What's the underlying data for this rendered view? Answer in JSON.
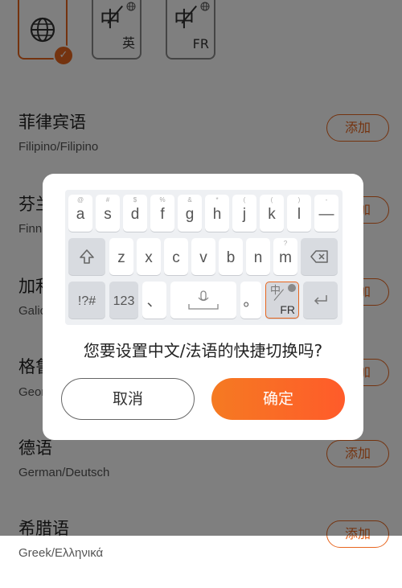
{
  "top_keys": [
    {
      "icon": "globe-icon",
      "selected": true
    },
    {
      "zh": "中",
      "sub": "英"
    },
    {
      "zh": "中",
      "sub": "FR"
    }
  ],
  "languages": [
    {
      "name": "菲律宾语",
      "native": "Filipino/Filipino",
      "action": "添加"
    },
    {
      "name": "芬兰语",
      "native": "Finnish/Suomi",
      "action": "添加"
    },
    {
      "name": "加利西亚语",
      "native": "Galician/Galego",
      "action": "添加"
    },
    {
      "name": "格鲁吉亚语",
      "native": "Georgian/ქართული",
      "action": "添加"
    },
    {
      "name": "德语",
      "native": "German/Deutsch",
      "action": "添加"
    },
    {
      "name": "希腊语",
      "native": "Greek/Ελληνικά",
      "action": "添加"
    }
  ],
  "dialog": {
    "keyboard": {
      "row1": [
        {
          "hint": "@",
          "label": "a"
        },
        {
          "hint": "#",
          "label": "s"
        },
        {
          "hint": "$",
          "label": "d"
        },
        {
          "hint": "%",
          "label": "f"
        },
        {
          "hint": "&",
          "label": "g"
        },
        {
          "hint": "*",
          "label": "h"
        },
        {
          "hint": "(",
          "label": "j"
        },
        {
          "hint": "(",
          "label": "k"
        },
        {
          "hint": ")",
          "label": "l"
        },
        {
          "hint": "-",
          "label": "—"
        }
      ],
      "row2": [
        {
          "hint": "",
          "label": "z"
        },
        {
          "hint": "",
          "label": "x"
        },
        {
          "hint": "",
          "label": "c"
        },
        {
          "hint": "",
          "label": "v"
        },
        {
          "hint": "",
          "label": "b"
        },
        {
          "hint": "",
          "label": "n"
        },
        {
          "hint": "?",
          "label": "m"
        }
      ],
      "symbols_label": "!?#",
      "numbers_label": "123",
      "comma_label": "、",
      "period_label": "。",
      "switch_zh": "中",
      "switch_label": "FR"
    },
    "question": "您要设置中文/法语的快捷切换吗?",
    "cancel_label": "取消",
    "confirm_label": "确定"
  },
  "colors": {
    "accent": "#e8661f",
    "overlay": "rgba(0,0,0,0.5)"
  }
}
